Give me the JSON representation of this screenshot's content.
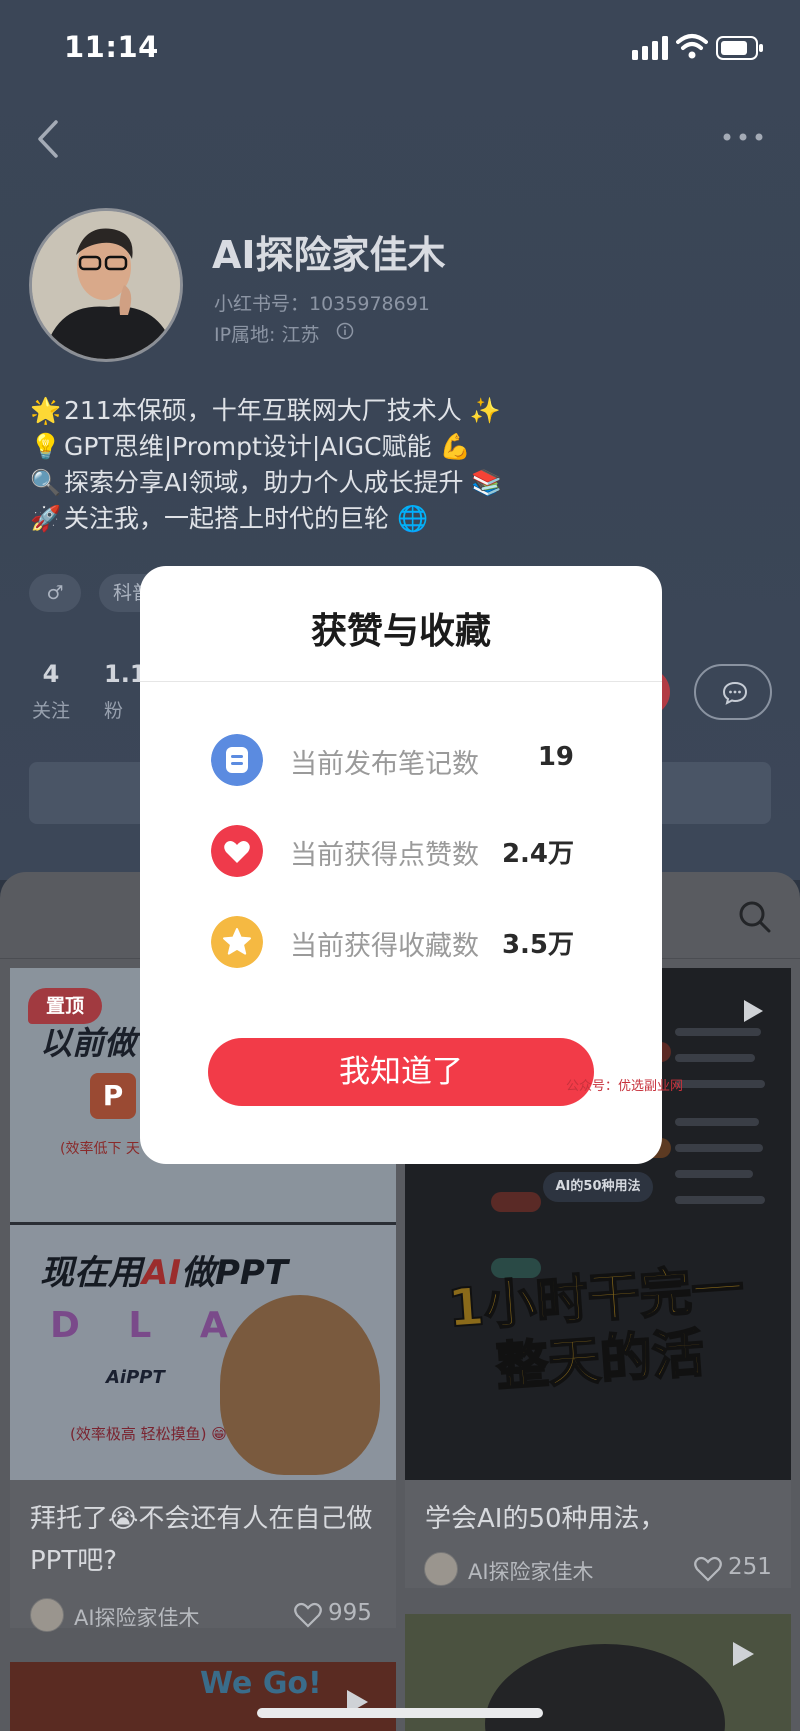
{
  "status_bar": {
    "time": "11:14"
  },
  "profile": {
    "name": "AI探险家佳木",
    "redbook_id": "小红书号：1035978691",
    "ip_location": "IP属地: 江苏",
    "bio": [
      {
        "emoji": "🌟",
        "text": "211本保硕，十年互联网大厂技术人 ✨"
      },
      {
        "emoji": "💡",
        "text": "GPT思维|Prompt设计|AIGC赋能 💪"
      },
      {
        "emoji": "🔍",
        "text": "探索分享AI领域，助力个人成长提升 📚"
      },
      {
        "emoji": "🚀",
        "text": "关注我，一起搭上时代的巨轮 🌐"
      }
    ],
    "tags": {
      "gender": "♂",
      "category": "科普"
    },
    "stats": {
      "follow_count": "4",
      "follow_label": "关注",
      "fans_count": "1.1",
      "fans_label": "粉"
    }
  },
  "feed": {
    "cards": [
      {
        "badge": "置顶",
        "thumb_top_title": "以前做",
        "thumb_top_note": "(效率低下 天",
        "thumb_bottom_title_pre": "现在用",
        "thumb_bottom_title_ai": "AI",
        "thumb_bottom_title_post": "做PPT",
        "thumb_brands": "D L A",
        "thumb_aippt": "AiPPT",
        "thumb_bottom_note": "(效率极高 轻松摸鱼) 😁",
        "title": "拜托了😭不会还有人在自己做PPT吧?",
        "author": "AI探险家佳木",
        "likes": "995"
      },
      {
        "thumb_center": "AI的50种用法",
        "thumb_big_text": "1小时干完一整天的活",
        "title": "学会AI的50种用法，",
        "author": "AI探险家佳木",
        "likes": "251"
      }
    ],
    "third_card_text": "We Go!"
  },
  "modal": {
    "title": "获赞与收藏",
    "rows": [
      {
        "label": "当前发布笔记数",
        "value": "19",
        "icon": "note-icon",
        "color": "#5b8be0"
      },
      {
        "label": "当前获得点赞数",
        "value": "2.4万",
        "icon": "heart-icon",
        "color": "#ef3a4b"
      },
      {
        "label": "当前获得收藏数",
        "value": "3.5万",
        "icon": "star-icon",
        "color": "#f5b942"
      }
    ],
    "confirm": "我知道了",
    "watermark": "公众号：优选副业网"
  }
}
